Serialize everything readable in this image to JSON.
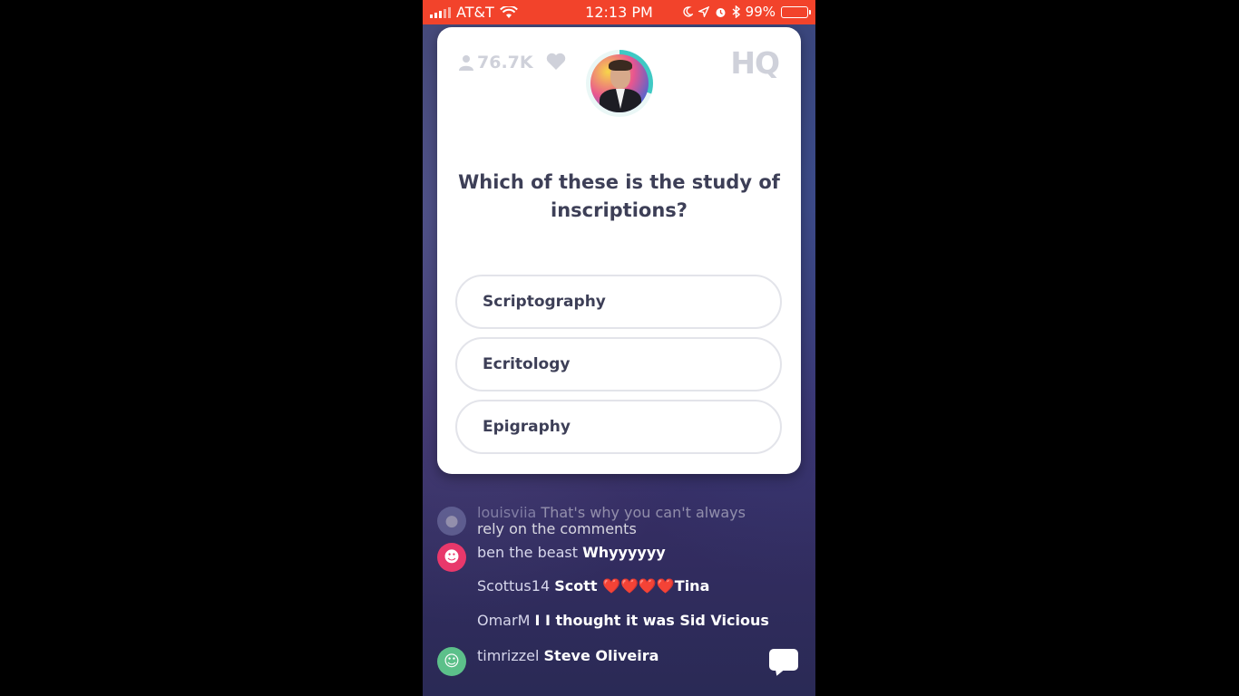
{
  "status_bar": {
    "carrier": "AT&T",
    "time": "12:13 PM",
    "battery": "99%",
    "battery_level": 0.99,
    "background_color": "#f2432b"
  },
  "card": {
    "viewers": "76.7K",
    "logo": "HQ",
    "question": "Which of these is the study of inscriptions?",
    "answers": [
      {
        "label": "Scriptography"
      },
      {
        "label": "Ecritology"
      },
      {
        "label": "Epigraphy"
      }
    ],
    "timer_progress": 0.3
  },
  "chat": {
    "messages": [
      {
        "user": "louisviia",
        "text": "That's why you can't always",
        "text2": "rely on the comments"
      },
      {
        "user": "ben the beast",
        "text": "Whyyyyyy"
      },
      {
        "user": "Scottus14",
        "text": "Scott ❤️❤️❤️❤️Tina"
      },
      {
        "user": "OmarM",
        "text": "I I thought it was Sid Vicious"
      },
      {
        "user": "timrizzel",
        "text": "Steve Oliveira"
      }
    ]
  },
  "icons": {
    "signal": "signal-bars-icon",
    "wifi": "wifi-icon",
    "moon": "moon-icon",
    "location": "location-arrow-icon",
    "alarm": "alarm-icon",
    "bluetooth": "bluetooth-icon",
    "battery": "battery-icon",
    "viewers": "person-icon",
    "heart": "heart-icon",
    "chat": "chat-bubble-icon"
  }
}
